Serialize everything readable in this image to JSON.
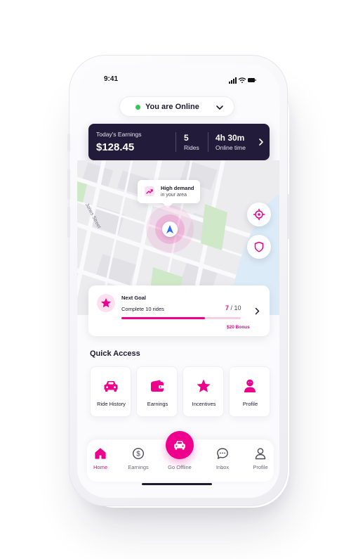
{
  "status_bar": {
    "time": "9:41"
  },
  "online_toggle": {
    "label": "You are Online",
    "status_color": "#34c759"
  },
  "earnings_card": {
    "label": "Today's Earnings",
    "amount": "$128.45",
    "rides_value": "5",
    "rides_label": "Rides",
    "online_time_value": "4h 30m",
    "online_time_label": "Online time"
  },
  "map": {
    "street_label": "Jones Street",
    "demand_title": "High demand",
    "demand_subtitle": "in your area"
  },
  "goal": {
    "title": "Next Goal",
    "task": "Complete 10 rides",
    "current": "7",
    "separator": " / ",
    "target": "10",
    "progress": 0.7,
    "bonus": "$20 Bonus"
  },
  "quick_access": {
    "heading": "Quick Access",
    "items": [
      {
        "label": "Ride History",
        "icon": "car-icon"
      },
      {
        "label": "Earnings",
        "icon": "wallet-icon"
      },
      {
        "label": "Incentives",
        "icon": "star-icon"
      },
      {
        "label": "Profile",
        "icon": "person-icon"
      }
    ]
  },
  "tabbar": {
    "items": [
      {
        "label": "Home",
        "icon": "home-icon",
        "active": true
      },
      {
        "label": "Earnings",
        "icon": "dollar-icon",
        "active": false
      },
      {
        "label": "Go Offline",
        "icon": "car-icon",
        "active": false
      },
      {
        "label": "Inbox",
        "icon": "chat-icon",
        "active": false
      },
      {
        "label": "Profile",
        "icon": "person-icon",
        "active": false
      }
    ]
  },
  "colors": {
    "accent": "#ec008c",
    "card_dark": "#221c3a",
    "water": "#dcebf8",
    "park": "#cfe8c7"
  }
}
